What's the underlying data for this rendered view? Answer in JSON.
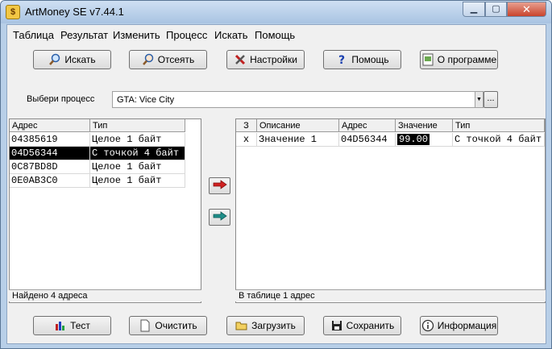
{
  "window": {
    "title": "ArtMoney SE v7.44.1"
  },
  "menu": [
    "Таблица",
    "Результат",
    "Изменить",
    "Процесс",
    "Искать",
    "Помощь"
  ],
  "toolbar": {
    "search": "Искать",
    "filter": "Отсеять",
    "settings": "Настройки",
    "help": "Помощь",
    "about": "О программе"
  },
  "process": {
    "label": "Выбери процесс",
    "value": "GTA: Vice City",
    "more": "..."
  },
  "left_table": {
    "headers": [
      "Адрес",
      "Тип"
    ],
    "rows": [
      {
        "addr": "04385619",
        "type": "Целое 1 байт"
      },
      {
        "addr": "04D56344",
        "type": "С точкой 4 байт"
      },
      {
        "addr": "0C87BD8D",
        "type": "Целое 1 байт"
      },
      {
        "addr": "0E0AB3C0",
        "type": "Целое 1 байт"
      }
    ],
    "status": "Найдено 4 адреса"
  },
  "right_table": {
    "headers": [
      "З",
      "Описание",
      "Адрес",
      "Значение",
      "Тип"
    ],
    "rows": [
      {
        "z": "x",
        "desc": "Значение 1",
        "addr": "04D56344",
        "value": "99.00",
        "type": "С точкой 4 байт"
      }
    ],
    "status": "В таблице 1 адрес"
  },
  "bottom": {
    "test": "Тест",
    "clear": "Очистить",
    "load": "Загрузить",
    "save": "Сохранить",
    "info": "Информация"
  },
  "colors": {
    "arrow_red": "#d02020",
    "arrow_teal": "#1f8f8a",
    "selection": "#000000"
  }
}
